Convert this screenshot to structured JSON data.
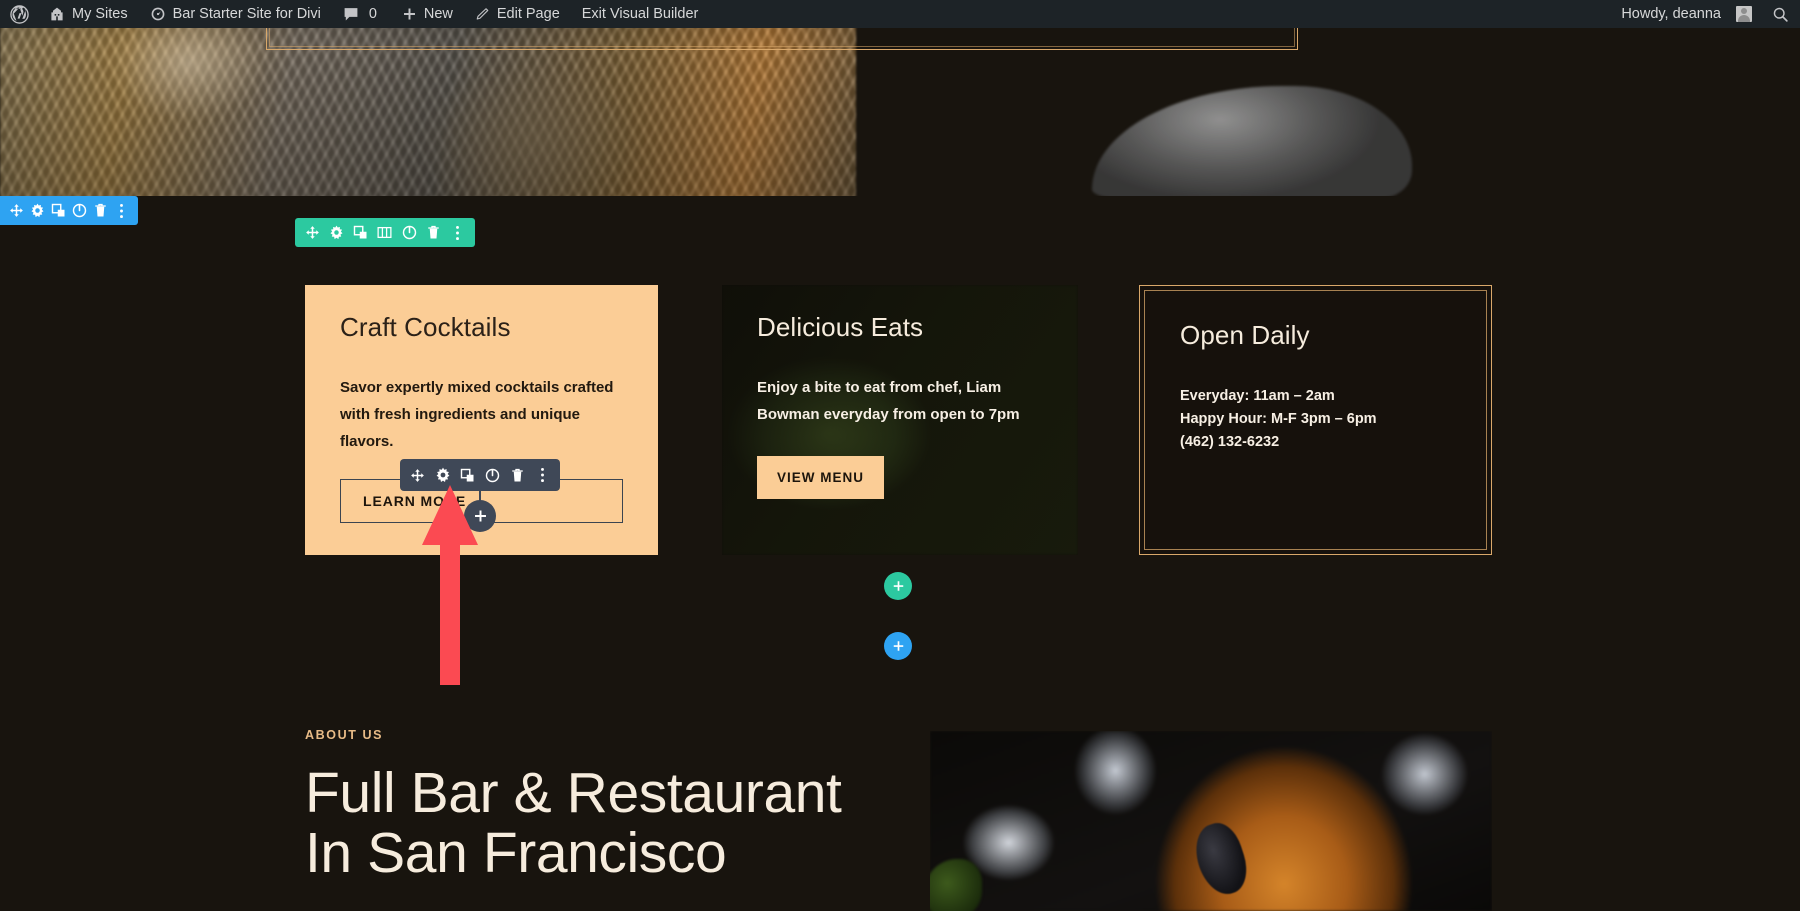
{
  "adminbar": {
    "wordpress_logo": "wordpress-logo",
    "my_sites": "My Sites",
    "site_name": "Bar Starter Site for Divi",
    "comment_count": "0",
    "new": "New",
    "edit_page": "Edit Page",
    "exit_visual_builder": "Exit Visual Builder",
    "howdy": "Howdy, deanna",
    "search_icon": "search-icon"
  },
  "toolbars": {
    "section": {
      "color": "#2ea3f2",
      "icons": [
        "move-icon",
        "gear-icon",
        "duplicate-icon",
        "power-icon",
        "trash-icon",
        "kebab-menu-icon"
      ]
    },
    "row": {
      "color": "#2cc9a0",
      "icons": [
        "move-icon",
        "gear-icon",
        "duplicate-icon",
        "columns-icon",
        "power-icon",
        "trash-icon",
        "kebab-menu-icon"
      ]
    },
    "module": {
      "color": "#3f4857",
      "icons": [
        "move-icon",
        "gear-icon",
        "duplicate-icon",
        "power-icon",
        "trash-icon",
        "kebab-menu-icon"
      ],
      "add_module_label": "add-module-plus"
    },
    "add_row_button": "add-row-plus",
    "add_section_button": "add-section-plus"
  },
  "cards": [
    {
      "title": "Craft Cocktails",
      "text": "Savor expertly mixed cocktails crafted with fresh ingredients and unique flavors.",
      "button": "LEARN MORE",
      "bg": "#fbcd96"
    },
    {
      "title": "Delicious Eats",
      "text": "Enjoy a bite to eat from chef, Liam Bowman everyday from open to 7pm",
      "button": "VIEW MENU",
      "bg": "image"
    },
    {
      "title": "Open Daily",
      "lines": [
        "Everyday: 11am – 2am",
        "Happy Hour: M-F 3pm – 6pm",
        "(462) 132-6232"
      ],
      "border": "#d9a86a"
    }
  ],
  "about": {
    "eyebrow": "ABOUT US",
    "title": "Full Bar & Restaurant\nIn San Francisco"
  },
  "annotation": {
    "arrow_color": "#fb4a52",
    "points_at": "gear-icon"
  },
  "colors": {
    "page_bg": "#18140e",
    "accent_peach": "#fbcd96",
    "accent_tan": "#d9a86a",
    "cream": "#f6ecdd",
    "admin_bar": "#1d2327"
  }
}
